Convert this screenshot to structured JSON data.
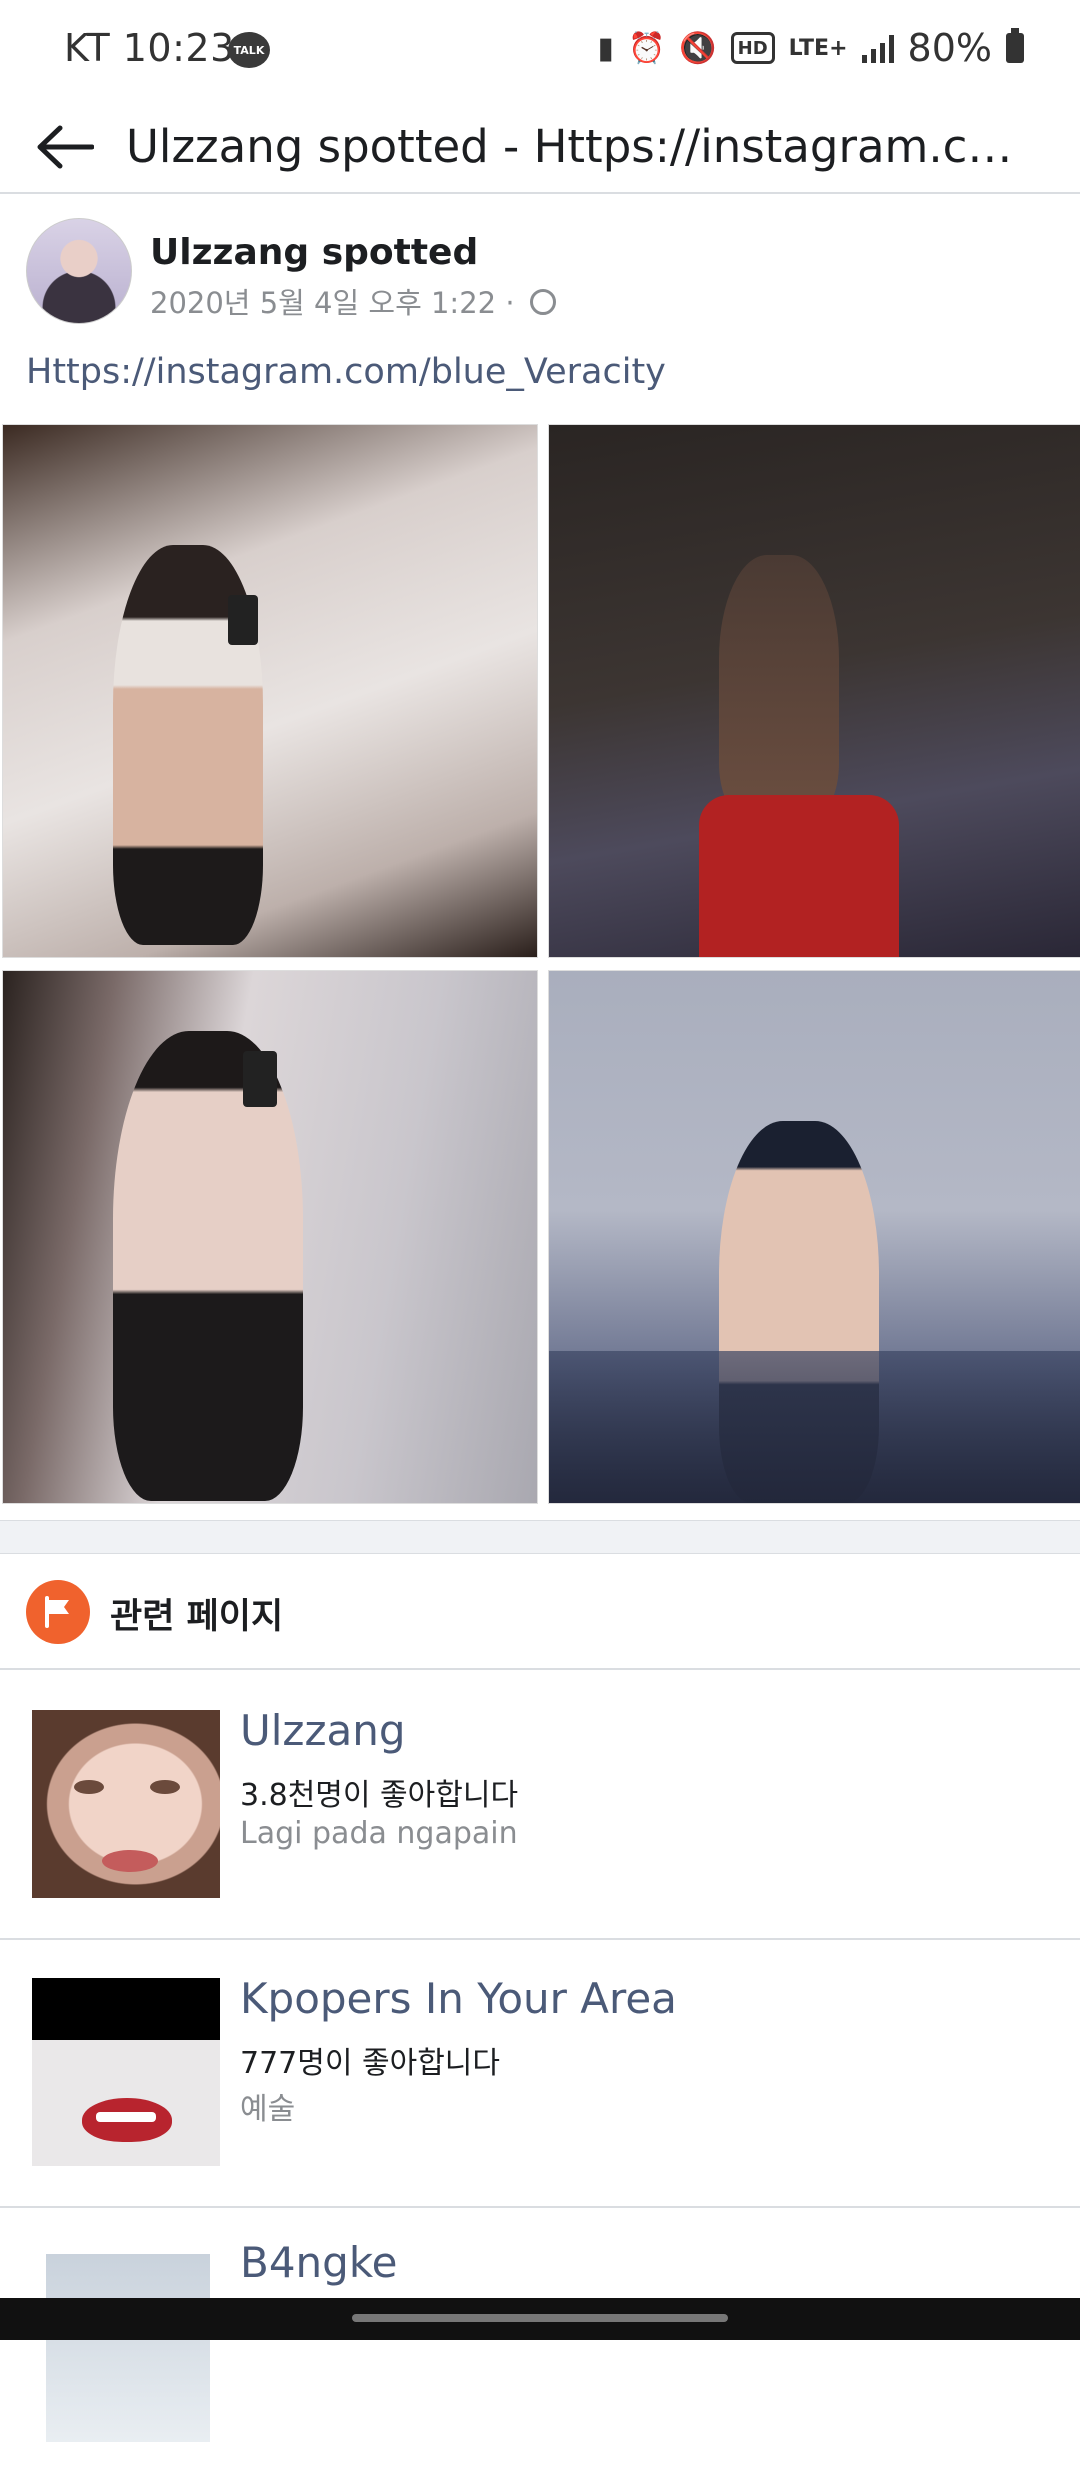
{
  "status_bar": {
    "carrier_time": "KT 10:23",
    "talk_badge": "TALK",
    "network": "LTE+",
    "hd": "HD",
    "battery": "80%"
  },
  "header": {
    "title": "Ulzzang spotted - Https://instagram.com/..."
  },
  "post": {
    "author": "Ulzzang spotted",
    "timestamp": "2020년 5월 4일 오후 1:22 ·",
    "text": "Https://instagram.com/blue_Veracity",
    "photos": [
      "photo-1",
      "photo-2",
      "photo-3",
      "photo-4"
    ]
  },
  "related": {
    "title": "관련 페이지",
    "pages": [
      {
        "name": "Ulzzang",
        "likes": "3.8천명이 좋아합니다",
        "category": "Lagi pada ngapain"
      },
      {
        "name": "Kpopers In Your Area",
        "likes": "777명이 좋아합니다",
        "category": "예술"
      },
      {
        "name": "B4ngke",
        "likes": "",
        "category": ""
      }
    ]
  },
  "colors": {
    "link": "#4b5a78",
    "accent_flag": "#f0622d",
    "divider": "#dadde1"
  }
}
